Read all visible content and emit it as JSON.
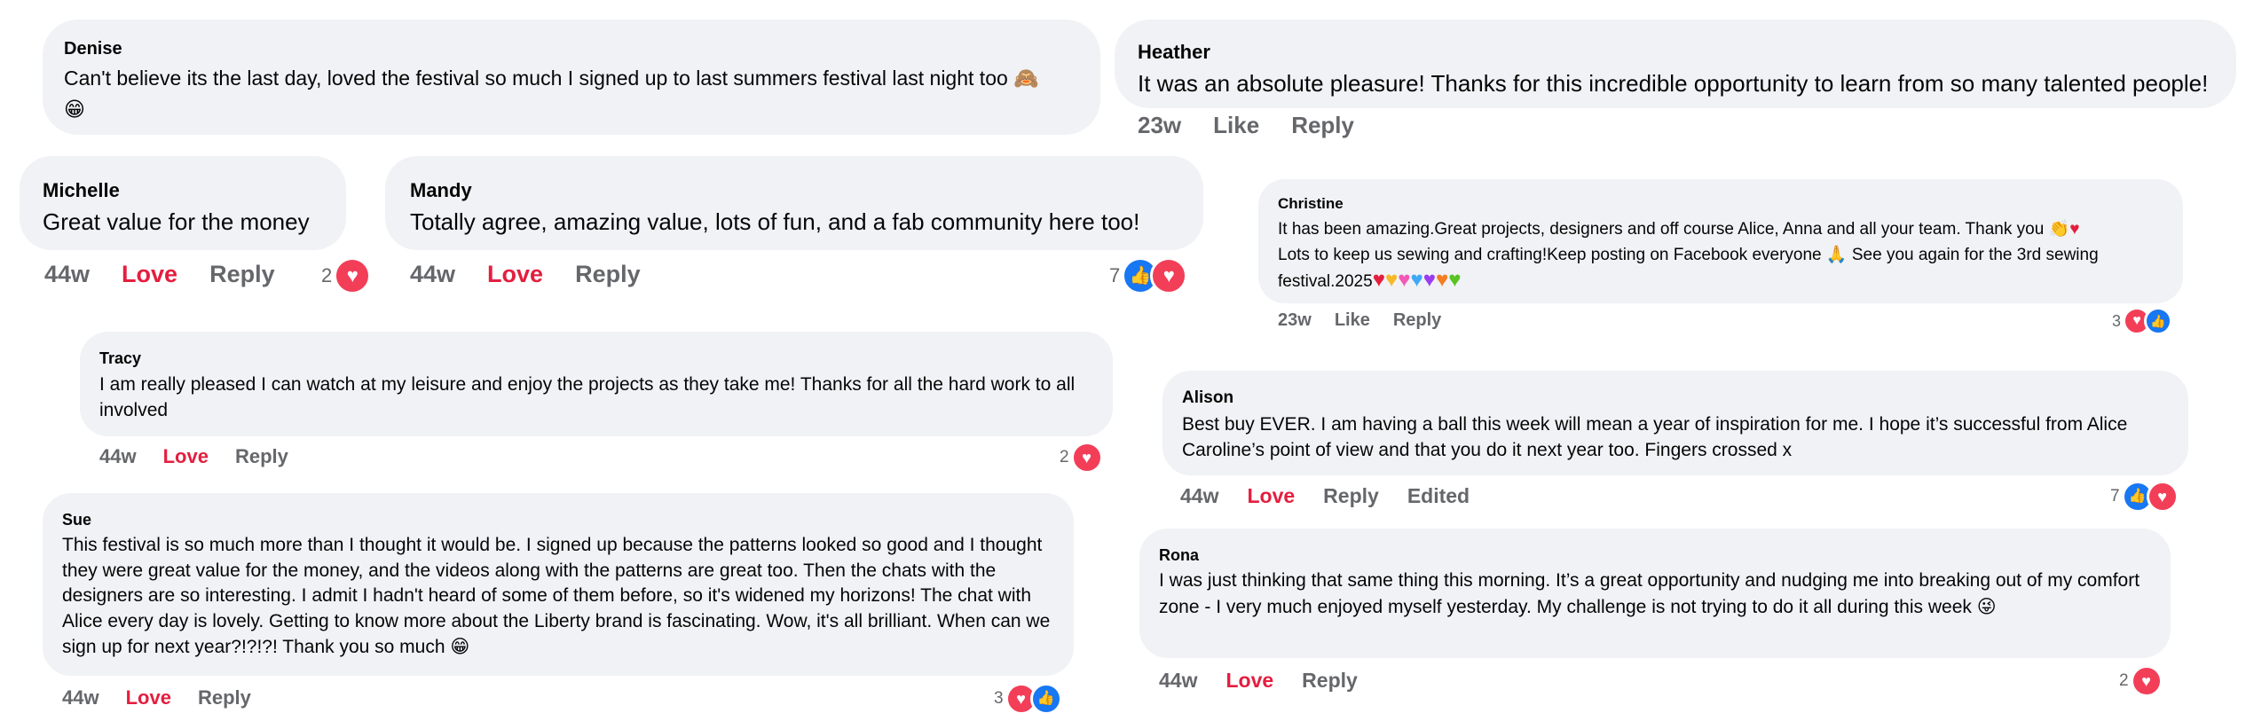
{
  "colors": {
    "bubble": "#f0f2f5",
    "meta": "#65676b",
    "love": "#e41e3f",
    "heart": "#f33e58",
    "like": "#1877f2"
  },
  "icons": {
    "heart": "heart-icon",
    "like": "like-icon"
  },
  "comments": {
    "denise": {
      "author": "Denise",
      "text": "Can't believe its the last day, loved the festival so much I signed up to last summers festival last night too",
      "emoji1": "🙈",
      "emoji2": "😁"
    },
    "heather": {
      "author": "Heather",
      "text": "It was an absolute pleasure! Thanks for this incredible opportunity to learn from so many talented people!",
      "time": "23w",
      "like": "Like",
      "reply": "Reply"
    },
    "michelle": {
      "author": "Michelle",
      "text": "Great value for the money",
      "time": "44w",
      "love": "Love",
      "reply": "Reply",
      "count": "2"
    },
    "mandy": {
      "author": "Mandy",
      "text": "Totally agree, amazing value, lots of fun, and a fab community here too!",
      "time": "44w",
      "love": "Love",
      "reply": "Reply",
      "count": "7"
    },
    "christine": {
      "author": "Christine",
      "line1": "It has been amazing.Great projects, designers and off course Alice, Anna and all your team. Thank you",
      "line2a": "Lots to keep us sewing and crafting!Keep posting on Facebook everyone",
      "line2b": "See you again for the 3rd sewing",
      "line3": "festival.2025",
      "hearts": [
        "#e41e3f",
        "#f7b928",
        "#f25ab7",
        "#3fa9f5",
        "#9b3cf0",
        "#f57d22",
        "#58c322"
      ],
      "time": "23w",
      "like": "Like",
      "reply": "Reply",
      "count": "3"
    },
    "tracy": {
      "author": "Tracy",
      "text": "I am really pleased I can watch at my leisure and enjoy the projects as they take me! Thanks for all the hard work to all involved",
      "time": "44w",
      "love": "Love",
      "reply": "Reply",
      "count": "2"
    },
    "alison": {
      "author": "Alison",
      "text": "Best buy EVER. I am having a ball this week will mean a year of inspiration for me. I hope it’s successful from Alice Caroline’s point of view and that you do it next year too. Fingers crossed x",
      "time": "44w",
      "love": "Love",
      "reply": "Reply",
      "edited": "Edited",
      "count": "7"
    },
    "sue": {
      "author": "Sue",
      "text": "This festival is so much more than I thought it would be. I signed up because the patterns looked so good and I thought they were great value for the money, and the videos along with the patterns are great too. Then the chats with the designers are so interesting. I admit I hadn't heard of some of them before, so it's widened my horizons! The chat with Alice every day is lovely. Getting to know more about the Liberty brand is fascinating. Wow, it's all brilliant. When can we sign up for next year?!?!?! Thank you so much",
      "time": "44w",
      "love": "Love",
      "reply": "Reply",
      "count": "3"
    },
    "rona": {
      "author": "Rona",
      "text": "I was just thinking that same thing this morning. It’s a great opportunity and nudging me into breaking out of my comfort zone - I very much enjoyed myself yesterday. My challenge is not trying to do it all during this week",
      "time": "44w",
      "love": "Love",
      "reply": "Reply",
      "count": "2"
    }
  }
}
